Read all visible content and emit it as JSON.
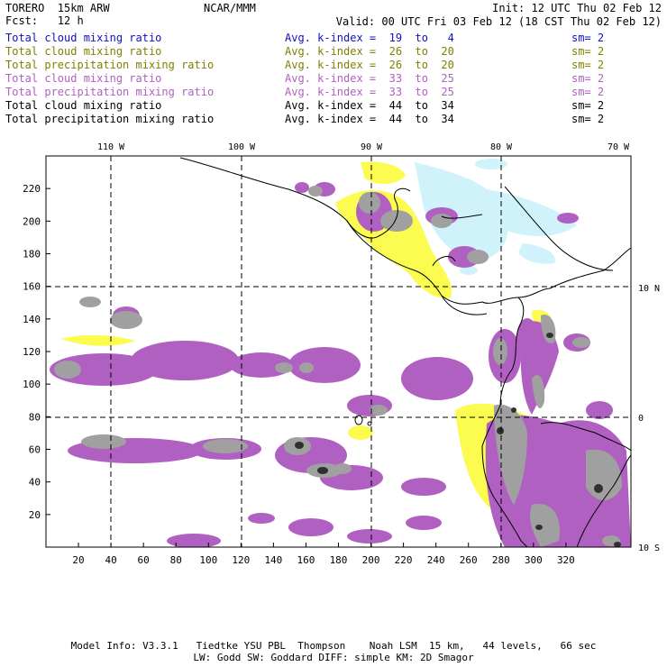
{
  "header": {
    "model": "TORERO  15km ARW",
    "forecast": "Fcst:   12 h",
    "center": "NCAR/MMM",
    "init": "Init: 12 UTC Thu 02 Feb 12",
    "valid": "Valid: 00 UTC Fri 03 Feb 12 (18 CST Thu 02 Feb 12)"
  },
  "legend": [
    {
      "name": "Total cloud mixing ratio",
      "k": "Avg. k-index =  19  to   4",
      "sm": "sm= 2",
      "color": "#1010c8"
    },
    {
      "name": "Total cloud mixing ratio",
      "k": "Avg. k-index =  26  to  20",
      "sm": "sm= 2",
      "color": "#808000"
    },
    {
      "name": "Total precipitation mixing ratio",
      "k": "Avg. k-index =  26  to  20",
      "sm": "sm= 2",
      "color": "#808000"
    },
    {
      "name": "Total cloud mixing ratio",
      "k": "Avg. k-index =  33  to  25",
      "sm": "sm= 2",
      "color": "#b060c0"
    },
    {
      "name": "Total precipitation mixing ratio",
      "k": "Avg. k-index =  33  to  25",
      "sm": "sm= 2",
      "color": "#b060c0"
    },
    {
      "name": "Total cloud mixing ratio",
      "k": "Avg. k-index =  44  to  34",
      "sm": "sm= 2",
      "color": "#000000"
    },
    {
      "name": "Total precipitation mixing ratio",
      "k": "Avg. k-index =  44  to  34",
      "sm": "sm= 2",
      "color": "#000000"
    }
  ],
  "map": {
    "lon_labels": [
      "110 W",
      "100 W",
      "90 W",
      "80 W",
      "70 W"
    ],
    "lat_labels": [
      "10 N",
      "0",
      "10 S"
    ],
    "x_ticks": [
      "20",
      "40",
      "60",
      "80",
      "100",
      "120",
      "140",
      "160",
      "180",
      "200",
      "220",
      "240",
      "260",
      "280",
      "300",
      "320"
    ],
    "y_ticks": [
      "20",
      "40",
      "60",
      "80",
      "100",
      "120",
      "140",
      "160",
      "180",
      "200",
      "220"
    ],
    "colors": {
      "cyan": "#cff2fb",
      "yellow": "#fbfb50",
      "purple": "#b060c0",
      "gray": "#a0a0a0",
      "dark": "#303030"
    }
  },
  "footer": {
    "line1": "Model Info: V3.3.1   Tiedtke YSU PBL  Thompson    Noah LSM  15 km,   44 levels,   66 sec",
    "line2": "LW: Godd SW: Goddard DIFF: simple KM: 2D Smagor"
  }
}
